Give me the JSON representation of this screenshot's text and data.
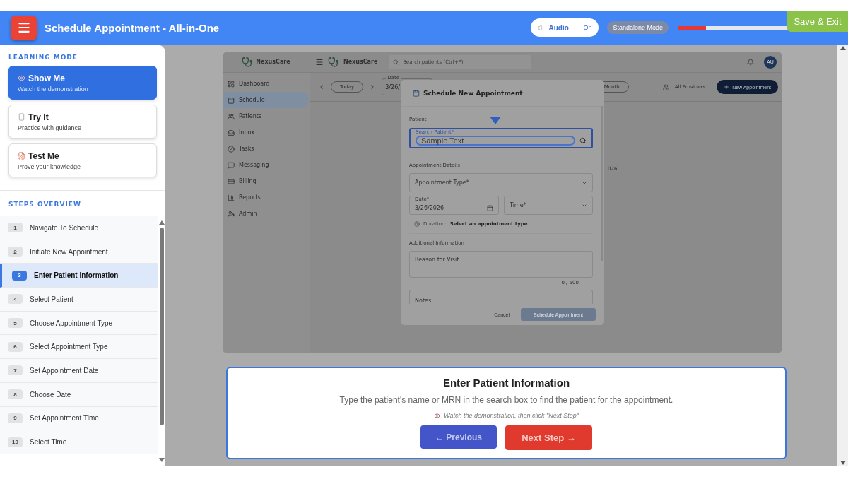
{
  "header": {
    "title": "Schedule Appointment - All-in-One",
    "audio": {
      "label": "Audio",
      "state": "On"
    },
    "mode_badge": "Standalone Mode",
    "progress": {
      "level": 0.25
    },
    "save_exit": "Save & Exit"
  },
  "learning_mode": {
    "heading": "LEARNING MODE",
    "modes": [
      {
        "kind": "watch",
        "title": "Show Me",
        "subtitle": "Watch the demonstration",
        "selected": true
      },
      {
        "kind": "practice",
        "title": "Try It",
        "subtitle": "Practice with guidance",
        "selected": false
      },
      {
        "kind": "test",
        "title": "Test Me",
        "subtitle": "Prove your knowledge",
        "selected": false
      }
    ]
  },
  "steps_overview": {
    "heading": "STEPS OVERVIEW",
    "steps": [
      {
        "number": "1",
        "label": "Navigate To Schedule",
        "selected": false
      },
      {
        "number": "2",
        "label": "Initiate New Appointment",
        "selected": false
      },
      {
        "number": "3",
        "label": "Enter Patient Information",
        "selected": true
      },
      {
        "number": "4",
        "label": "Select Patient",
        "selected": false
      },
      {
        "number": "5",
        "label": "Choose Appointment Type",
        "selected": false
      },
      {
        "number": "6",
        "label": "Select Appointment Type",
        "selected": false
      },
      {
        "number": "7",
        "label": "Set Appointment Date",
        "selected": false
      },
      {
        "number": "8",
        "label": "Choose Date",
        "selected": false
      },
      {
        "number": "9",
        "label": "Set Appointment Time",
        "selected": false
      },
      {
        "number": "10",
        "label": "Select Time",
        "selected": false
      }
    ]
  },
  "demo_app": {
    "brand_sidebar": "NexusCare",
    "brand_topbar": "NexusCare",
    "search_placeholder": "Search patients (Ctrl+P)",
    "avatar": "AU",
    "nav": [
      {
        "kind": "dashboard",
        "label": "Dashboard",
        "selected": false
      },
      {
        "kind": "schedule",
        "label": "Schedule",
        "selected": true
      },
      {
        "kind": "patients",
        "label": "Patients",
        "selected": false
      },
      {
        "kind": "inbox",
        "label": "Inbox",
        "selected": false
      },
      {
        "kind": "tasks",
        "label": "Tasks",
        "selected": false
      },
      {
        "kind": "messaging",
        "label": "Messaging",
        "selected": false
      },
      {
        "kind": "billing",
        "label": "Billing",
        "selected": false
      },
      {
        "kind": "reports",
        "label": "Reports",
        "selected": false
      },
      {
        "kind": "admin",
        "label": "Admin",
        "selected": false
      }
    ],
    "toolbar": {
      "today": "Today",
      "date_label": "Date",
      "date_value": "3/26/",
      "view": "Month",
      "providers": "All Providers",
      "new_appointment": "New Appointment"
    },
    "background_text": "026.",
    "modal": {
      "title": "Schedule New Appointment",
      "patient_section": "Patient",
      "search_label": "Search Patient*",
      "search_value": "Sample Text",
      "details_section": "Appointment Details",
      "type_placeholder": "Appointment Type*",
      "date_label": "Date*",
      "date_value": "3/26/2026",
      "time_placeholder": "Time*",
      "duration_label": "Duration:",
      "duration_value": "Select an appointment type",
      "additional_section": "Additional Information",
      "reason_placeholder": "Reason for Visit",
      "counter": "0 / 500",
      "notes_placeholder": "Notes",
      "cancel": "Cancel",
      "submit": "Schedule Appointment"
    }
  },
  "instruction": {
    "title": "Enter Patient Information",
    "body": "Type the patient's name or MRN in the search box to find the patient for the appointment.",
    "hint": "Watch the demonstration, then click \"Next Step\"",
    "previous": "← Previous",
    "next": "Next Step →"
  }
}
